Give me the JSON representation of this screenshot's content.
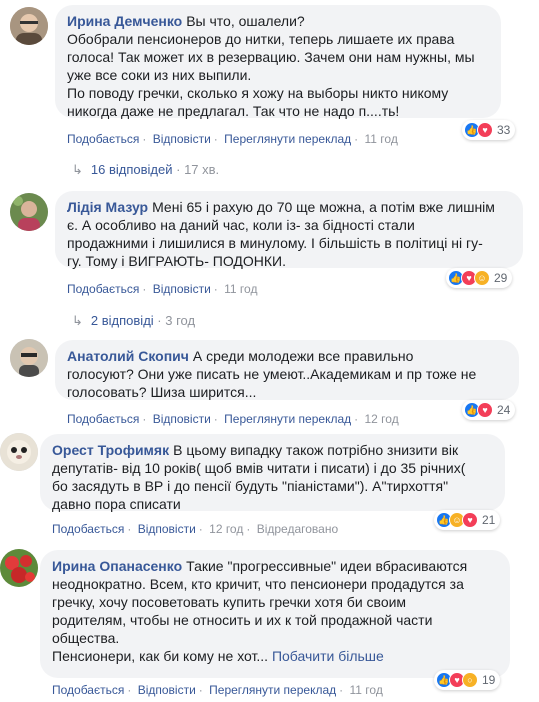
{
  "comments": [
    {
      "author": "Ирина Демченко",
      "text_lines": [
        "Вы что, ошалели?",
        "Обобрали пенсионеров до нитки, теперь лишаете их права",
        "голоса! Так может их в резервацию. Зачем они нам нужны, мы",
        "уже все соки из них выпили.",
        "По поводу гречки, сколько я хожу на выборы никто никому",
        "никогда даже не предлагал. Так что не надо п....ть!"
      ],
      "actions": [
        "Подобається",
        "Відповісти",
        "Переглянути переклад"
      ],
      "time": "11 год",
      "reaction_count": "33",
      "replies": {
        "label": "16 відповідей",
        "time": "17 хв."
      }
    },
    {
      "author": "Лідія Мазур",
      "text_lines": [
        "Мені 65 і рахую до 70 ще можна, а потім вже лишнім",
        "є. А особливо на даний час, коли із- за бідності стали",
        "продажними і лишилися в минулому. І більшість в політиці ні гу-",
        "гу. Тому і ВИГРАЮТЬ- ПОДОНКИ."
      ],
      "actions": [
        "Подобається",
        "Відповісти"
      ],
      "time": "11 год",
      "reaction_count": "29",
      "replies": {
        "label": "2 відповіді",
        "time": "3 год"
      }
    },
    {
      "author": "Анатолий Скопич",
      "text_lines": [
        "А среди молодежи все правильно",
        "голосуют? Они уже писать не умеют..Академикам и пр тоже не",
        "голосовать? Шиза ширится..."
      ],
      "actions": [
        "Подобається",
        "Відповісти",
        "Переглянути переклад"
      ],
      "time": "12 год",
      "reaction_count": "24"
    },
    {
      "author": "Орест Трофимяк",
      "text_lines": [
        "В цьому випадку також потрібно знизити вік",
        "депутатів- від 10 років( щоб вмів читати і писати) і до 35 річних(",
        "бо засядуть в ВР і до пенсії будуть \"піаністами\"). А\"тирхоття\"",
        "давно пора списати"
      ],
      "actions": [
        "Подобається",
        "Відповісти"
      ],
      "time": "12 год",
      "edited": "Відредаговано",
      "reaction_count": "21"
    },
    {
      "author": "Ирина Опанасенко",
      "text_lines": [
        "Такие \"прогрессивные\" идеи вбрасиваются",
        "неоднократно. Всем, кто кричит, что пенсионери продадутся за",
        "гречку, хочу посоветовать купить гречки хотя би своим",
        "родителям, чтобы не относить и их к той продажной части",
        "общества.",
        "Пенсионери, как би кому не хот..."
      ],
      "see_more": "Побачити більше",
      "actions": [
        "Подобається",
        "Відповісти",
        "Переглянути переклад"
      ],
      "time": "11 год",
      "reaction_count": "19"
    }
  ]
}
